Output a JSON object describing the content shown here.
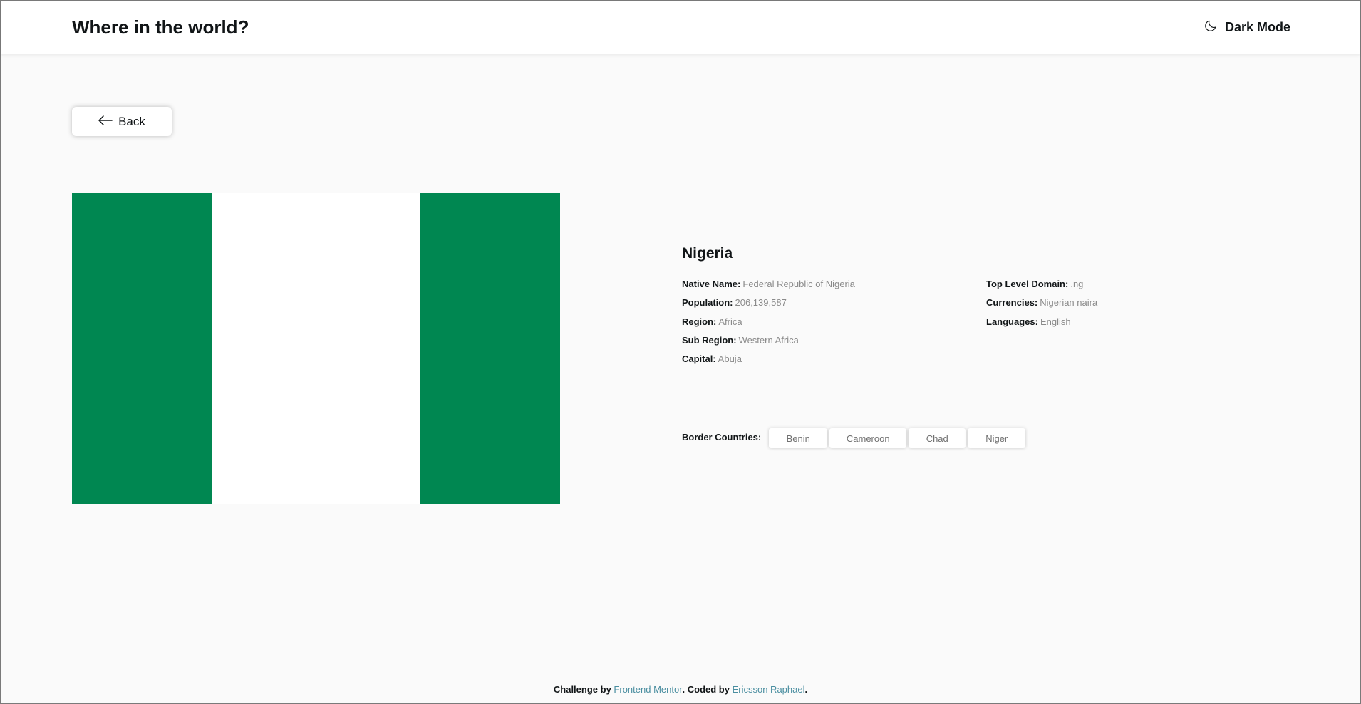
{
  "header": {
    "title": "Where in the world?",
    "theme_toggle_label": "Dark Mode",
    "theme_icon": "moon-icon"
  },
  "back_button": {
    "label": "Back",
    "icon": "arrow-left-icon"
  },
  "flag": {
    "alt": "Nigeria flag",
    "colors": [
      "#008751",
      "#ffffff",
      "#008751"
    ]
  },
  "country": {
    "name": "Nigeria",
    "left_info": [
      {
        "label": "Native Name:",
        "value": "Federal Republic of Nigeria"
      },
      {
        "label": "Population:",
        "value": "206,139,587"
      },
      {
        "label": "Region:",
        "value": "Africa"
      },
      {
        "label": "Sub Region:",
        "value": "Western Africa"
      },
      {
        "label": "Capital:",
        "value": "Abuja"
      }
    ],
    "right_info": [
      {
        "label": "Top Level Domain:",
        "value": ".ng"
      },
      {
        "label": "Currencies:",
        "value": "Nigerian naira"
      },
      {
        "label": "Languages:",
        "value": "English"
      }
    ],
    "border_label": "Border Countries:",
    "borders": [
      "Benin",
      "Cameroon",
      "Chad",
      "Niger"
    ]
  },
  "footer": {
    "prefix": "Challenge by ",
    "link1": "Frontend Mentor",
    "middle": ". Coded by ",
    "link2": "Ericsson Raphael",
    "suffix": "."
  },
  "colors": {
    "background": "#fafafa",
    "header_bg": "#ffffff",
    "text": "#111517",
    "muted": "#8a8a8a",
    "link": "#4a8ea0"
  }
}
